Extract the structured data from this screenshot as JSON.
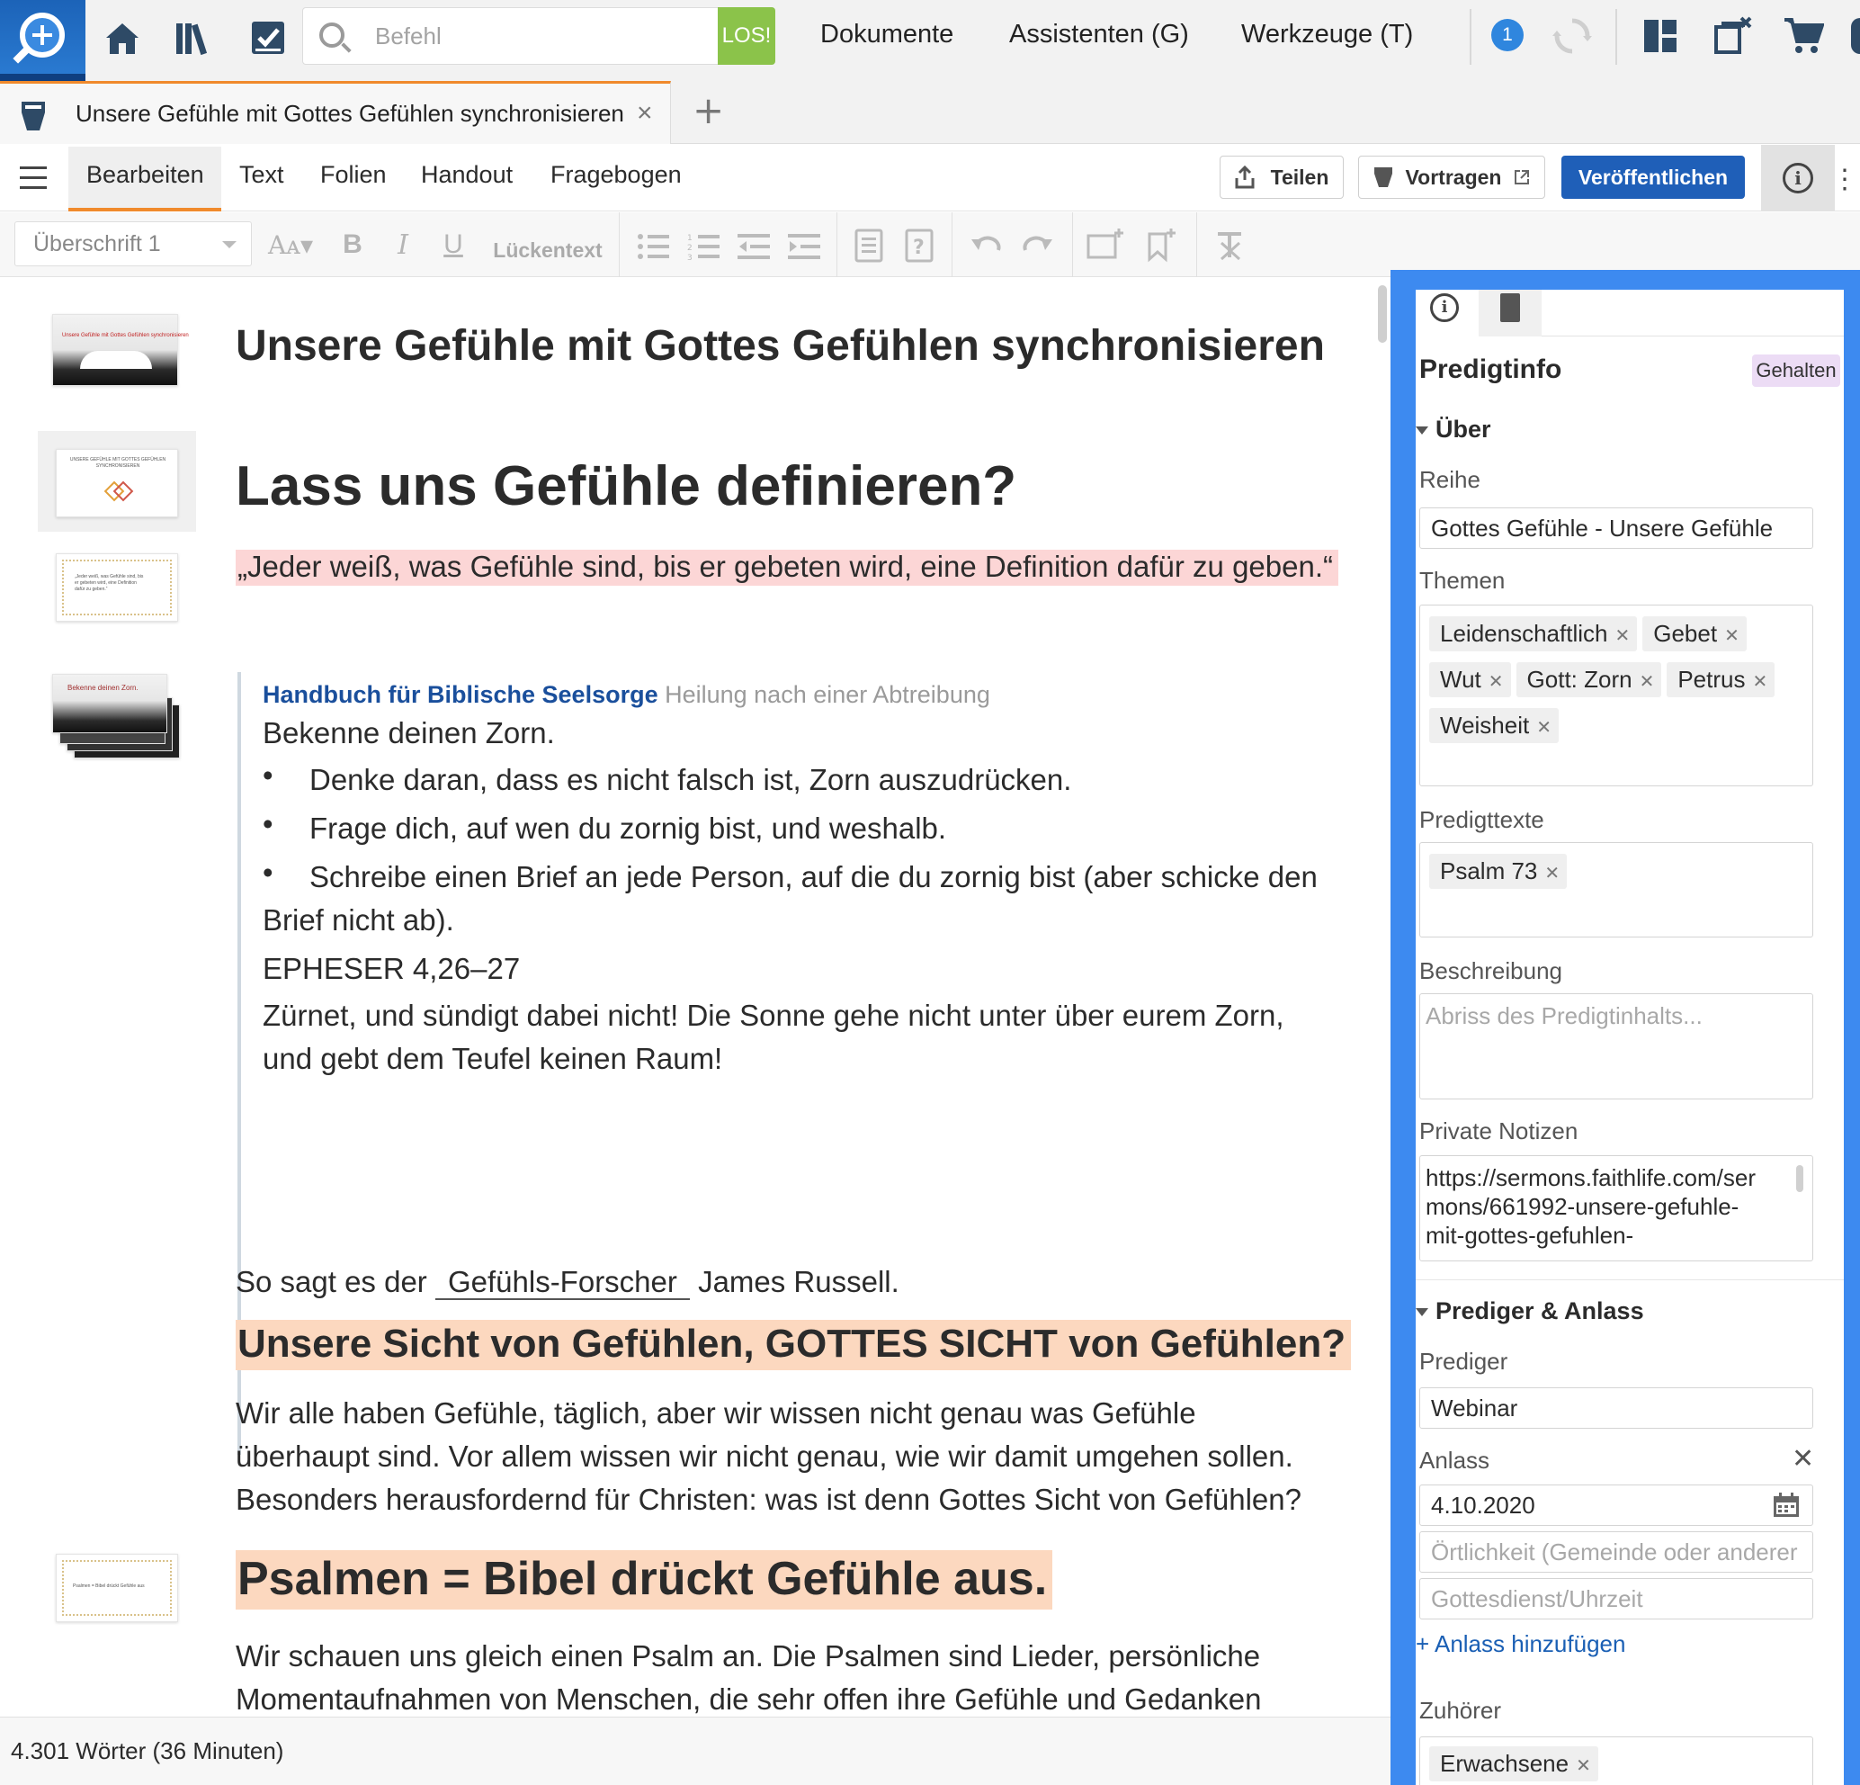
{
  "topbar": {
    "search_placeholder": "Befehl",
    "go_label": "LOS!",
    "menu": [
      "Dokumente",
      "Assistenten (G)",
      "Werkzeuge (T)"
    ],
    "notification_count": "1"
  },
  "tab": {
    "title": "Unsere Gefühle mit Gottes Gefühlen synchronisieren",
    "close": "×",
    "add": "+"
  },
  "ribbon": {
    "tabs": [
      "Bearbeiten",
      "Text",
      "Folien",
      "Handout",
      "Fragebogen"
    ],
    "share": "Teilen",
    "present": "Vortragen",
    "publish": "Veröffentlichen"
  },
  "format": {
    "style": "Überschrift 1",
    "cloze": "Lückentext"
  },
  "document": {
    "title": "Unsere Gefühle mit Gottes Gefühlen synchronisieren",
    "heading_define": "Lass uns Gefühle definieren?",
    "quote": "„Jeder weiß, was Gefühle sind, bis er gebeten wird, eine Definition dafür zu geben.“",
    "excerpt": {
      "source_title": "Handbuch für Biblische Seelsorge",
      "source_section": "Heilung nach einer Abtreibung",
      "intro": "Bekenne deinen Zorn.",
      "bullets": [
        "Denke daran, dass es nicht falsch ist, Zorn auszudrücken.",
        "Frage dich, auf wen du zornig bist, und weshalb.",
        "Schreibe einen Brief an jede Person, auf die du zornig bist (aber schicke den",
        "Brief nicht ab)."
      ],
      "reference": "EPHESER 4,26–27",
      "verse_1": "Zürnet, und sündigt dabei nicht! Die Sonne gehe nicht unter über eurem Zorn,",
      "verse_2": "und gebt dem Teufel keinen Raum!"
    },
    "russell_before": "So sagt es der",
    "russell_blank": "Gefühls-Forscher",
    "russell_after": "James Russell.",
    "heading_sight": "Unsere Sicht von Gefühlen, GOTTES SICHT von Gefühlen?",
    "para_sight": [
      "Wir alle haben Gefühle, täglich, aber wir wissen nicht genau was Gefühle",
      "überhaupt sind. Vor allem wissen wir nicht genau, wie wir damit umgehen sollen.",
      "Besonders herausfordernd für Christen: was ist denn Gottes Sicht von Gefühlen?"
    ],
    "heading_psalm": "Psalmen = Bibel drückt Gefühle aus.",
    "para_psalm": [
      "Wir schauen uns gleich einen Psalm an. Die Psalmen sind Lieder, persönliche",
      "Momentaufnahmen von Menschen, die sehr offen ihre Gefühle und Gedanken"
    ],
    "thumb_texts": [
      "Unsere Gefühle mit Gottes Gefühlen synchronisieren",
      "UNSERE GEFÜHLE MIT GOTTES GEFÜHLEN SYNCHRONISIEREN",
      "„Jeder weiß, was Gefühle sind, bis er gebeten wird, eine Definition dafür zu geben.“",
      "Bekenne deinen Zorn.",
      "Psalmen = Bibel drückt Gefühle aus"
    ]
  },
  "status": {
    "word_count": "4.301 Wörter (36 Minuten)"
  },
  "panel": {
    "title": "Predigtinfo",
    "status_badge": "Gehalten",
    "section_about": "Über",
    "series_label": "Reihe",
    "series_value": "Gottes Gefühle - Unsere Gefühle",
    "topics_label": "Themen",
    "topics": [
      "Leidenschaftlich",
      "Gebet",
      "Wut",
      "Gott: Zorn",
      "Petrus",
      "Weisheit"
    ],
    "texts_label": "Predigttexte",
    "texts": [
      "Psalm 73"
    ],
    "description_label": "Beschreibung",
    "description_placeholder": "Abriss des Predigtinhalts...",
    "notes_label": "Private Notizen",
    "notes_lines": [
      "https://sermons.faithlife.com/ser",
      "mons/661992-unsere-gefuhle-",
      "mit-gottes-gefuhlen-"
    ],
    "section_preacher": "Prediger & Anlass",
    "preacher_label": "Prediger",
    "preacher_value": "Webinar",
    "occasion_label": "Anlass",
    "occasion_date": "4.10.2020",
    "location_placeholder": "Örtlichkeit (Gemeinde oder anderer",
    "service_placeholder": "Gottesdienst/Uhrzeit",
    "add_occasion": "+ Anlass hinzufügen",
    "audience_label": "Zuhörer",
    "audience": [
      "Erwachsene"
    ]
  }
}
